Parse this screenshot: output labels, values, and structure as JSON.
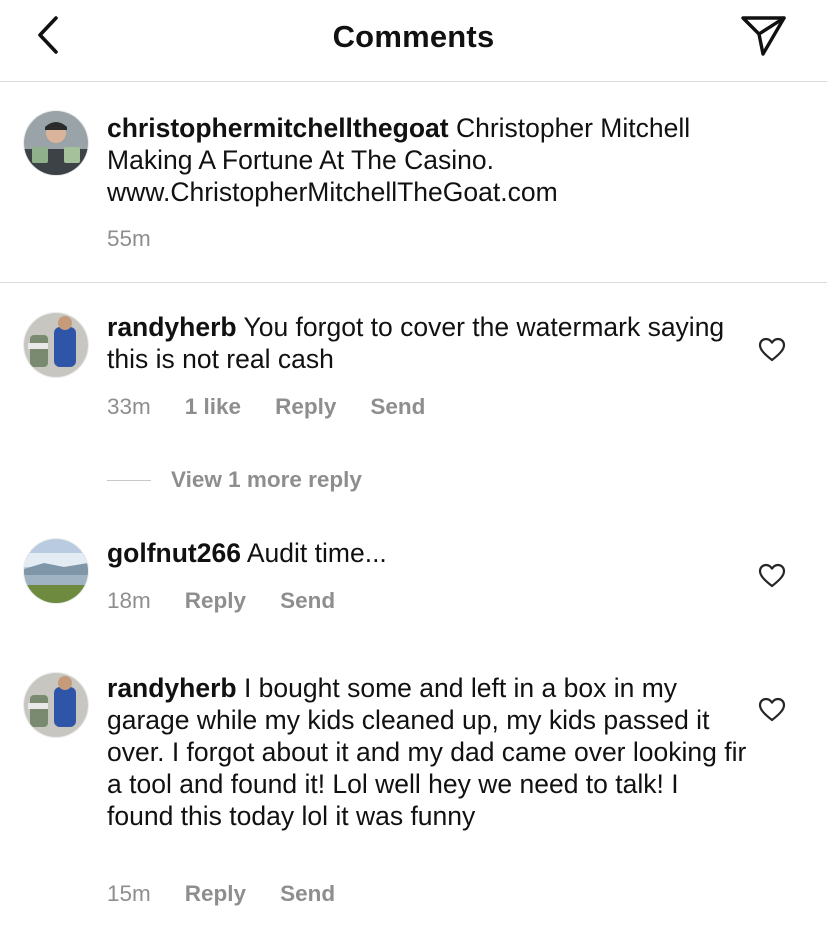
{
  "header": {
    "title": "Comments",
    "back_icon": "chevron-left-icon",
    "share_icon": "paper-plane-icon"
  },
  "caption": {
    "username": "christophermitchellthegoat",
    "text": " Christopher Mitchell Making A Fortune At The Casino. www.ChristopherMitchellTheGoat.com",
    "time": "55m"
  },
  "comments": [
    {
      "username": "randyherb",
      "text": " You forgot to cover the watermark saying this is not real cash",
      "time": "33m",
      "likes": "1 like",
      "reply": "Reply",
      "send": "Send"
    },
    {
      "username": "golfnut266",
      "text": " Audit time...",
      "time": "18m",
      "reply": "Reply",
      "send": "Send"
    },
    {
      "username": "randyherb",
      "text": " I bought some and left in a box in my garage while my kids cleaned up, my kids passed it over. I forgot about it and my dad came over looking fir a tool and found it! Lol well hey we need to talk! I found this today lol it was funny",
      "time": "15m",
      "reply": "Reply",
      "send": "Send"
    }
  ],
  "view_more_replies": "View 1 more reply",
  "colors": {
    "secondary_text": "#8e8e8e",
    "divider": "#dbdbdb",
    "primary_text": "#111111"
  }
}
